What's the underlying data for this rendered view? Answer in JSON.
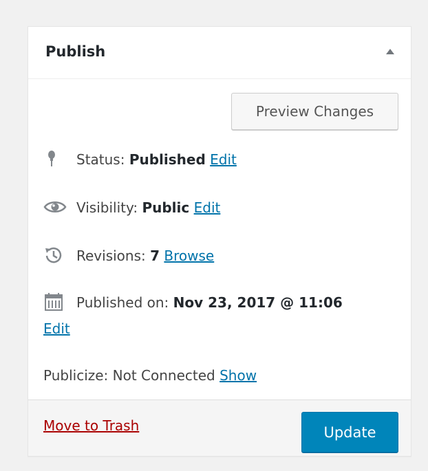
{
  "box": {
    "title": "Publish"
  },
  "actions": {
    "preview_label": "Preview Changes",
    "update_label": "Update",
    "trash_label": "Move to Trash"
  },
  "status": {
    "label": "Status:",
    "value": "Published",
    "edit_label": "Edit",
    "icon": "pin-icon"
  },
  "visibility": {
    "label": "Visibility:",
    "value": "Public",
    "edit_label": "Edit",
    "icon": "eye-icon"
  },
  "revisions": {
    "label": "Revisions:",
    "value": "7",
    "browse_label": "Browse",
    "icon": "history-icon"
  },
  "published": {
    "label": "Published on:",
    "value": "Nov 23, 2017 @ 11:06",
    "edit_label": "Edit",
    "icon": "calendar-icon"
  },
  "publicize": {
    "label": "Publicize: Not Connected",
    "show_label": "Show"
  },
  "colors": {
    "link": "#0073aa",
    "trash": "#a00",
    "primary": "#0085ba"
  }
}
